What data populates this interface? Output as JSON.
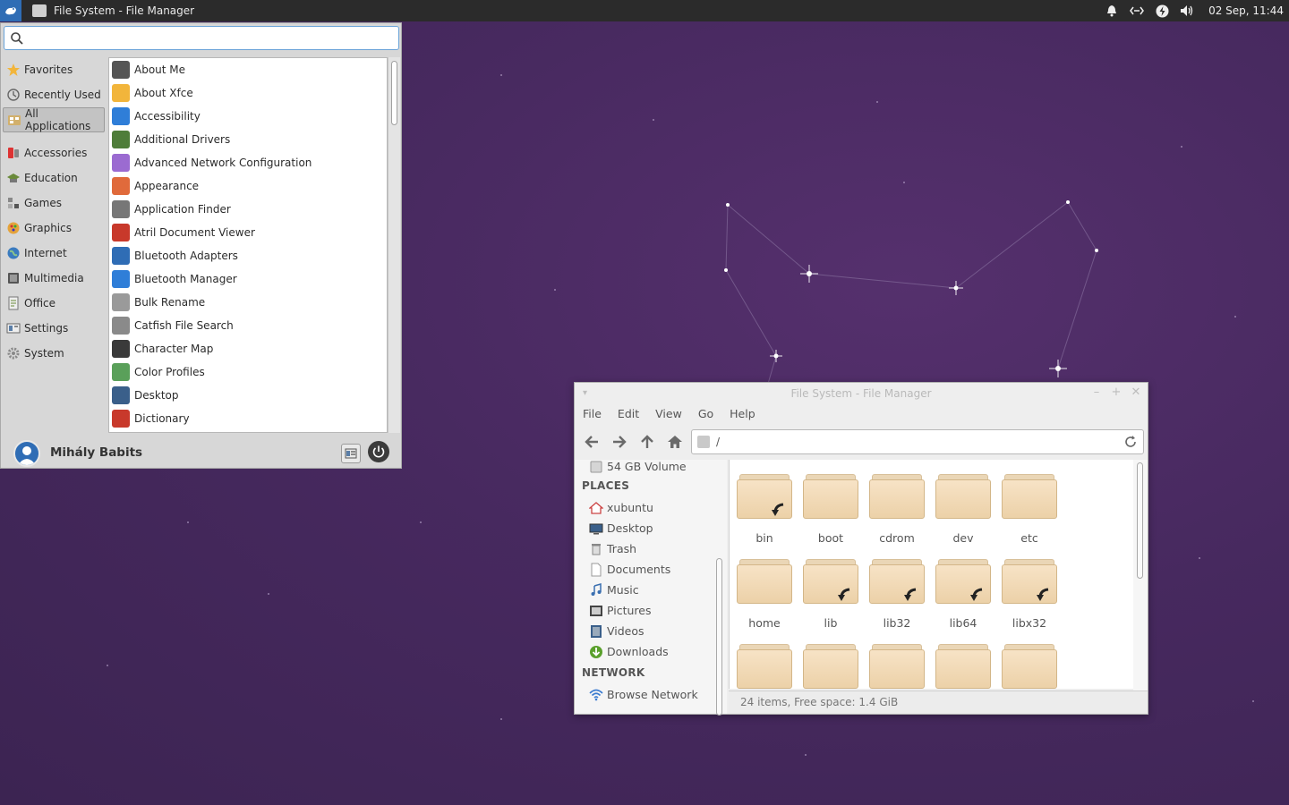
{
  "panel": {
    "window_button_label": "File System - File Manager",
    "clock": "02 Sep, 11:44"
  },
  "menu": {
    "search": {
      "value": "",
      "placeholder": ""
    },
    "categories": [
      {
        "label": "Favorites",
        "icon": "star-icon"
      },
      {
        "label": "Recently Used",
        "icon": "clock-icon"
      },
      {
        "label": "All Applications",
        "icon": "apps-icon",
        "selected": true
      },
      {
        "label": "Accessories",
        "icon": "accessories-icon"
      },
      {
        "label": "Education",
        "icon": "education-icon"
      },
      {
        "label": "Games",
        "icon": "games-icon"
      },
      {
        "label": "Graphics",
        "icon": "graphics-icon"
      },
      {
        "label": "Internet",
        "icon": "globe-icon"
      },
      {
        "label": "Multimedia",
        "icon": "multimedia-icon"
      },
      {
        "label": "Office",
        "icon": "office-icon"
      },
      {
        "label": "Settings",
        "icon": "settings-icon"
      },
      {
        "label": "System",
        "icon": "system-icon"
      }
    ],
    "applications": [
      {
        "label": "About Me",
        "icon": "person-icon",
        "color": "#555555"
      },
      {
        "label": "About Xfce",
        "icon": "star-icon",
        "color": "#f2b53b"
      },
      {
        "label": "Accessibility",
        "icon": "accessibility-icon",
        "color": "#2f7ed8"
      },
      {
        "label": "Additional Drivers",
        "icon": "chip-icon",
        "color": "#4f7d3a"
      },
      {
        "label": "Advanced Network Configuration",
        "icon": "network-icon",
        "color": "#9b6bd1"
      },
      {
        "label": "Appearance",
        "icon": "palette-icon",
        "color": "#e06a3b"
      },
      {
        "label": "Application Finder",
        "icon": "magnifier-icon",
        "color": "#777777"
      },
      {
        "label": "Atril Document Viewer",
        "icon": "document-viewer-icon",
        "color": "#c8392b"
      },
      {
        "label": "Bluetooth Adapters",
        "icon": "bluetooth-device-icon",
        "color": "#2f6db5"
      },
      {
        "label": "Bluetooth Manager",
        "icon": "bluetooth-icon",
        "color": "#2f7ed8"
      },
      {
        "label": "Bulk Rename",
        "icon": "rename-icon",
        "color": "#9a9a9a"
      },
      {
        "label": "Catfish File Search",
        "icon": "file-search-icon",
        "color": "#8a8a8a"
      },
      {
        "label": "Character Map",
        "icon": "character-map-icon",
        "color": "#3a3a3a"
      },
      {
        "label": "Color Profiles",
        "icon": "color-profiles-icon",
        "color": "#5aa05a"
      },
      {
        "label": "Desktop",
        "icon": "desktop-icon",
        "color": "#3a5f8a"
      },
      {
        "label": "Dictionary",
        "icon": "dictionary-icon",
        "color": "#c8392b"
      }
    ],
    "user_name": "Mihály Babits"
  },
  "file_manager": {
    "title": "File System - File Manager",
    "menubar": [
      "File",
      "Edit",
      "View",
      "Go",
      "Help"
    ],
    "location": "/",
    "sidebar": {
      "devices": [
        {
          "label": "54 GB Volume",
          "icon": "drive-icon"
        }
      ],
      "places_header": "PLACES",
      "places": [
        {
          "label": "xubuntu",
          "icon": "home-icon"
        },
        {
          "label": "Desktop",
          "icon": "desktop-icon"
        },
        {
          "label": "Trash",
          "icon": "trash-icon"
        },
        {
          "label": "Documents",
          "icon": "document-icon"
        },
        {
          "label": "Music",
          "icon": "music-icon"
        },
        {
          "label": "Pictures",
          "icon": "pictures-icon"
        },
        {
          "label": "Videos",
          "icon": "videos-icon"
        },
        {
          "label": "Downloads",
          "icon": "downloads-icon"
        }
      ],
      "network_header": "NETWORK",
      "network": [
        {
          "label": "Browse Network",
          "icon": "wifi-icon"
        }
      ]
    },
    "items": [
      {
        "name": "bin",
        "symlink": true
      },
      {
        "name": "boot",
        "symlink": false
      },
      {
        "name": "cdrom",
        "symlink": false
      },
      {
        "name": "dev",
        "symlink": false
      },
      {
        "name": "etc",
        "symlink": false
      },
      {
        "name": "home",
        "symlink": false
      },
      {
        "name": "lib",
        "symlink": true
      },
      {
        "name": "lib32",
        "symlink": true
      },
      {
        "name": "lib64",
        "symlink": true
      },
      {
        "name": "libx32",
        "symlink": true
      },
      {
        "name": "",
        "symlink": false
      },
      {
        "name": "",
        "symlink": false
      },
      {
        "name": "",
        "symlink": false
      },
      {
        "name": "",
        "symlink": false
      },
      {
        "name": "",
        "symlink": false
      }
    ],
    "status": "24 items, Free space: 1.4 GiB"
  }
}
